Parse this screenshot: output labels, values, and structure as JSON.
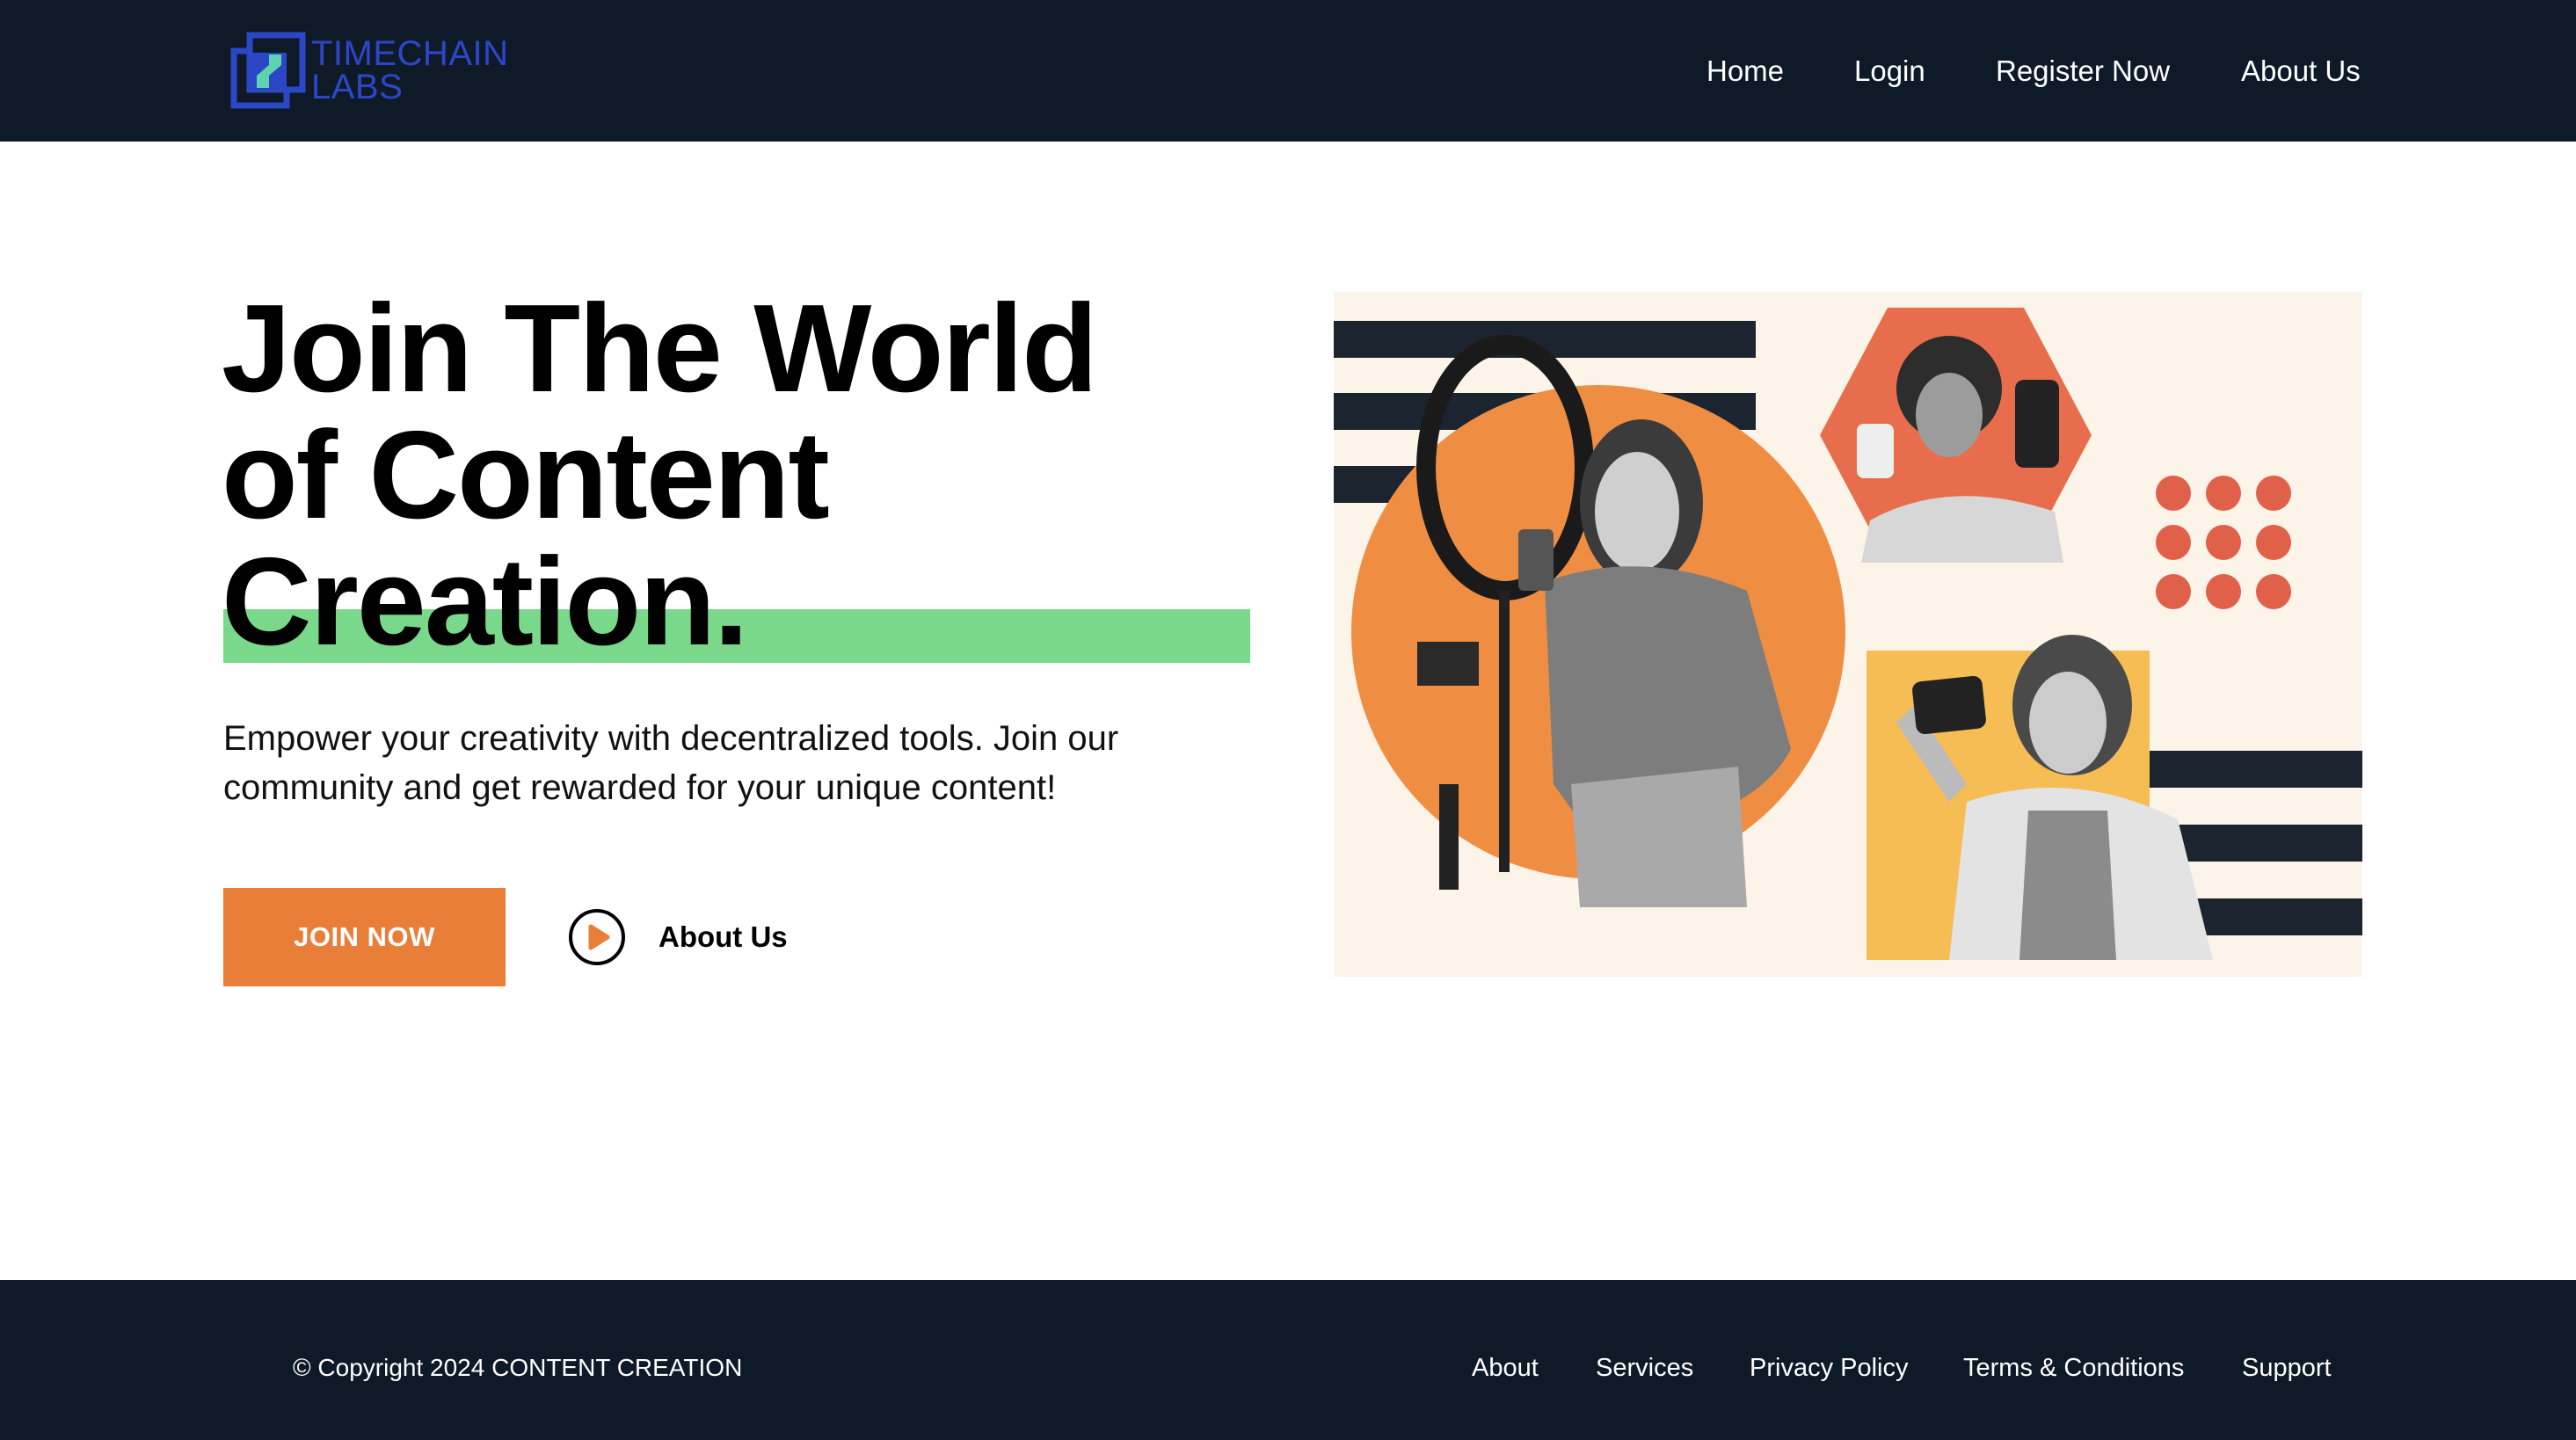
{
  "header": {
    "logo_text_line1": "TIMECHAIN",
    "logo_text_line2": "LABS",
    "nav": [
      {
        "label": "Home"
      },
      {
        "label": "Login"
      },
      {
        "label": "Register Now"
      },
      {
        "label": "About Us"
      }
    ]
  },
  "hero": {
    "title_line1": "Join The World",
    "title_line2": "of Content",
    "title_line3": "Creation.",
    "subtitle_line1": "Empower your creativity with decentralized tools. Join our",
    "subtitle_line2": "community and get rewarded for your unique content!",
    "join_button": "JOIN NOW",
    "about_link": "About Us",
    "play_icon": "play-circle-icon"
  },
  "illustration": {
    "description_icon": "content-creators-illustration"
  },
  "colors": {
    "header_bg": "#0f1a28",
    "accent_orange": "#e97e38",
    "highlight_green": "#7ad88a",
    "logo_blue": "#2c47c6",
    "logo_teal": "#5fd3b0"
  },
  "footer": {
    "copyright": "© Copyright 2024 CONTENT CREATION",
    "links": [
      {
        "label": "About"
      },
      {
        "label": "Services"
      },
      {
        "label": "Privacy Policy"
      },
      {
        "label": "Terms & Conditions"
      },
      {
        "label": "Support"
      }
    ]
  }
}
